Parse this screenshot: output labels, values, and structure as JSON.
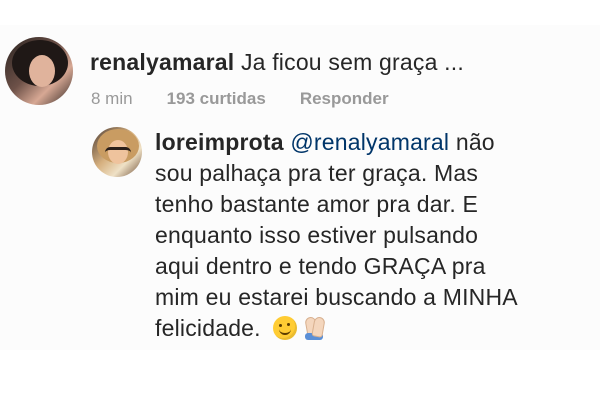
{
  "comment": {
    "username": "renalyamaral",
    "text": "Ja ficou sem graça ...",
    "time": "8 min",
    "likes": "193 curtidas",
    "reply_label": "Responder"
  },
  "reply": {
    "username": "loreimprota",
    "mention": "@renalyamaral",
    "line1_after_mention": "não",
    "line2": "sou palhaça pra ter graça. Mas",
    "line3": "tenho bastante amor pra dar. E",
    "line4": "enquanto isso estiver pulsando",
    "line5": "aqui dentro e tendo GRAÇA pra",
    "line6": "mim eu estarei buscando a MINHA",
    "line7": "felicidade.",
    "emoji_1": "smiling-face-icon",
    "emoji_2": "folded-hands-icon"
  },
  "colors": {
    "text": "#262626",
    "meta": "#999999",
    "mention": "#003569",
    "background": "#fcfcfc"
  }
}
